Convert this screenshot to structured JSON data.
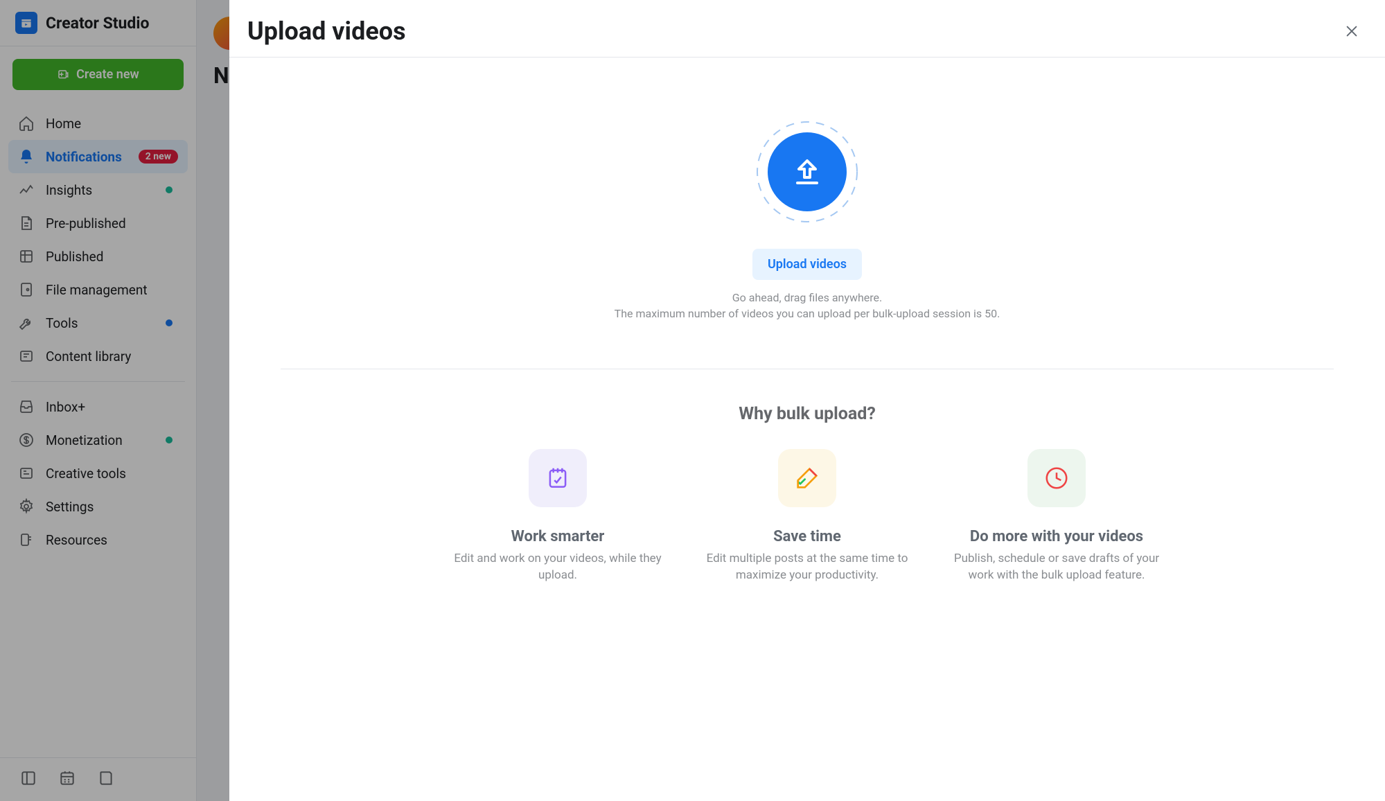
{
  "app": {
    "name": "Creator Studio"
  },
  "sidebar": {
    "create_button_label": "Create new",
    "items": [
      {
        "label": "Home"
      },
      {
        "label": "Notifications",
        "badge": "2 new"
      },
      {
        "label": "Insights"
      },
      {
        "label": "Pre-published"
      },
      {
        "label": "Published"
      },
      {
        "label": "File management"
      },
      {
        "label": "Tools"
      },
      {
        "label": "Content library"
      },
      {
        "label": "Inbox+"
      },
      {
        "label": "Monetization"
      },
      {
        "label": "Creative tools"
      },
      {
        "label": "Settings"
      },
      {
        "label": "Resources"
      }
    ]
  },
  "modal": {
    "title": "Upload videos",
    "upload_button_label": "Upload videos",
    "hint_line1": "Go ahead, drag files anywhere.",
    "hint_line2": "The maximum number of videos you can upload per bulk-upload session is 50.",
    "why_heading": "Why bulk upload?",
    "benefits": [
      {
        "title": "Work smarter",
        "desc": "Edit and work on your videos, while they upload."
      },
      {
        "title": "Save time",
        "desc": "Edit multiple posts at the same time to maximize your productivity."
      },
      {
        "title": "Do more with your videos",
        "desc": "Publish, schedule or save drafts of your work with the bulk upload feature."
      }
    ]
  }
}
